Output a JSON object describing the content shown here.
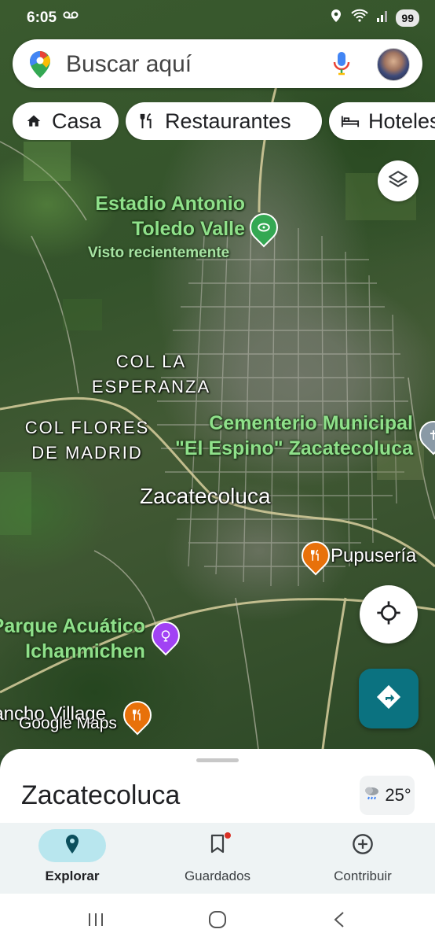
{
  "status_bar": {
    "time": "6:05",
    "voicemail_icon": "voicemail-icon",
    "icons": [
      "location-icon",
      "wifi-calling-icon",
      "signal-icon"
    ],
    "battery": "99"
  },
  "search": {
    "placeholder": "Buscar aquí",
    "logo_icon": "maps-pin-logo-icon",
    "mic_icon": "microphone-icon",
    "avatar_icon": "profile-avatar"
  },
  "chips": [
    {
      "label": "Casa",
      "icon": "home-icon"
    },
    {
      "label": "Restaurantes",
      "icon": "restaurant-icon"
    },
    {
      "label": "Hoteles",
      "icon": "hotel-bed-icon"
    }
  ],
  "map": {
    "labels": {
      "stadium_line1": "Estadio Antonio",
      "stadium_line2": "Toledo Valle",
      "stadium_sub": "Visto recientemente",
      "col_la_esperanza_1": "COL LA",
      "col_la_esperanza_2": "ESPERANZA",
      "col_flores_1": "COL FLORES",
      "col_flores_2": "DE MADRID",
      "cemetery_1": "Cementerio Municipal",
      "cemetery_2": "\"El Espino\" Zacatecoluca",
      "city": "Zacatecoluca",
      "pupuseria": "Pupusería",
      "parque_1": "Parque Acuático",
      "parque_2": "Ichanmichen",
      "village": "Rancho Village"
    },
    "watermark": "Google Maps"
  },
  "sheet": {
    "title": "Zacatecoluca",
    "temperature": "25°",
    "weather_icon": "partly-cloudy-rain-icon"
  },
  "bottom_nav": [
    {
      "label": "Explorar",
      "icon": "explore-pin-icon",
      "active": true
    },
    {
      "label": "Guardados",
      "icon": "bookmark-icon",
      "active": false,
      "badge": true
    },
    {
      "label": "Contribuir",
      "icon": "add-circle-icon",
      "active": false
    }
  ],
  "system_nav": [
    "recent-apps-icon",
    "home-button-icon",
    "back-icon"
  ],
  "colors": {
    "accent_teal": "#0b7280",
    "poi_green": "#34a853",
    "poi_orange": "#e8710a",
    "poi_purple": "#a142f4",
    "active_nav_bg": "#b8e6ee"
  }
}
